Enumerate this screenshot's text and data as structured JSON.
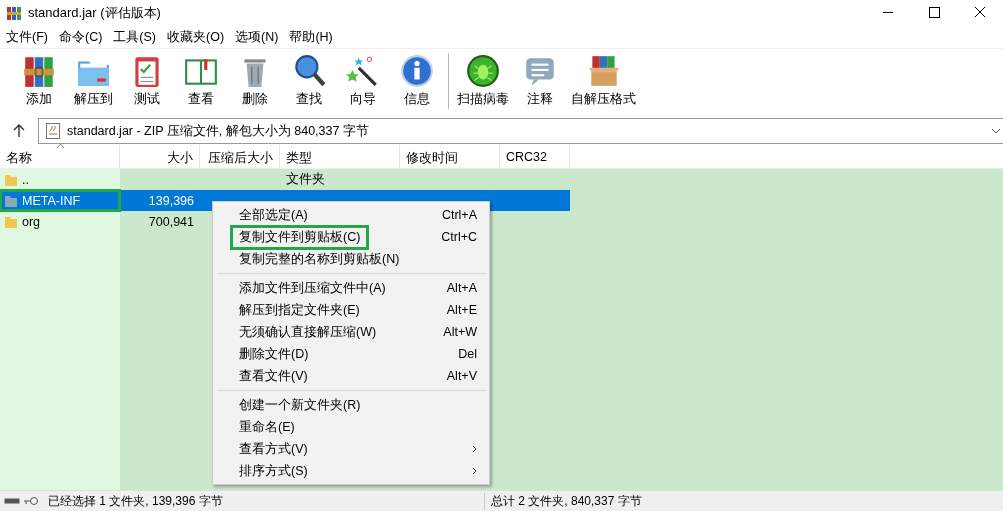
{
  "window": {
    "title": "standard.jar (评估版本)"
  },
  "menubar": [
    "文件(F)",
    "命令(C)",
    "工具(S)",
    "收藏夹(O)",
    "选项(N)",
    "帮助(H)"
  ],
  "toolbar": [
    {
      "label": "添加",
      "separator_before": false
    },
    {
      "label": "解压到",
      "separator_before": false
    },
    {
      "label": "测试",
      "separator_before": false
    },
    {
      "label": "查看",
      "separator_before": false
    },
    {
      "label": "删除",
      "separator_before": false
    },
    {
      "label": "查找",
      "separator_before": false
    },
    {
      "label": "向导",
      "separator_before": false
    },
    {
      "label": "信息",
      "separator_before": false
    },
    {
      "label": "扫描病毒",
      "separator_before": true
    },
    {
      "label": "注释",
      "separator_before": false
    },
    {
      "label": "自解压格式",
      "separator_before": false
    }
  ],
  "address": {
    "value": "standard.jar - ZIP 压缩文件, 解包大小为 840,337 字节"
  },
  "table": {
    "columns": [
      "名称",
      "大小",
      "压缩后大小",
      "类型",
      "修改时间",
      "CRC32"
    ],
    "rows": [
      {
        "name": "..",
        "type": "文件夹",
        "selected": false,
        "highlighted": false
      },
      {
        "name": "META-INF",
        "size": "139,396",
        "selected": true,
        "highlighted": true
      },
      {
        "name": "org",
        "size": "700,941",
        "selected": false,
        "highlighted": false
      }
    ]
  },
  "context_menu": [
    {
      "label": "全部选定(A)",
      "shortcut": "Ctrl+A",
      "separator_before": false,
      "submenu": false,
      "highlighted": false
    },
    {
      "label": "复制文件到剪贴板(C)",
      "shortcut": "Ctrl+C",
      "separator_before": false,
      "submenu": false,
      "highlighted": true
    },
    {
      "label": "复制完整的名称到剪贴板(N)",
      "separator_before": false,
      "submenu": false,
      "highlighted": false
    },
    {
      "label": "添加文件到压缩文件中(A)",
      "shortcut": "Alt+A",
      "separator_before": true,
      "submenu": false,
      "highlighted": false
    },
    {
      "label": "解压到指定文件夹(E)",
      "shortcut": "Alt+E",
      "separator_before": false,
      "submenu": false,
      "highlighted": false
    },
    {
      "label": "无须确认直接解压缩(W)",
      "shortcut": "Alt+W",
      "separator_before": false,
      "submenu": false,
      "highlighted": false
    },
    {
      "label": "删除文件(D)",
      "shortcut": "Del",
      "separator_before": false,
      "submenu": false,
      "highlighted": false
    },
    {
      "label": "查看文件(V)",
      "shortcut": "Alt+V",
      "separator_before": false,
      "submenu": false,
      "highlighted": false
    },
    {
      "label": "创建一个新文件夹(R)",
      "separator_before": true,
      "submenu": false,
      "highlighted": false
    },
    {
      "label": "重命名(E)",
      "separator_before": false,
      "submenu": false,
      "highlighted": false
    },
    {
      "label": "查看方式(V)",
      "separator_before": false,
      "submenu": true,
      "highlighted": false
    },
    {
      "label": "排序方式(S)",
      "separator_before": false,
      "submenu": true,
      "highlighted": false
    }
  ],
  "status_bar": {
    "left": "已经选择 1 文件夹, 139,396 字节",
    "right": "总计 2 文件夹, 840,337 字节"
  }
}
